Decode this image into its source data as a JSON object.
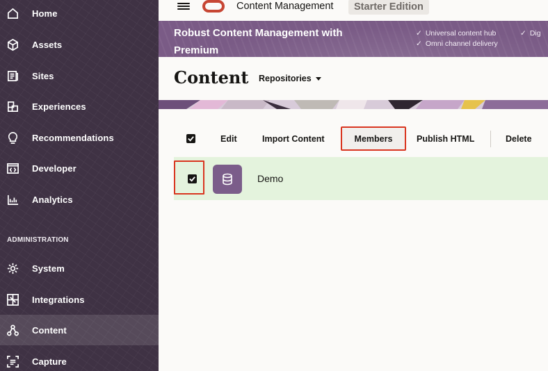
{
  "header": {
    "app_title": "Content Management",
    "edition": "Starter Edition"
  },
  "banner": {
    "title": "Robust Content Management with Premium",
    "features": [
      "Universal content hub",
      "Omni channel delivery",
      "Dig"
    ]
  },
  "sidebar": {
    "section_title": "ADMINISTRATION",
    "items": [
      {
        "label": "Home",
        "icon": "home-icon"
      },
      {
        "label": "Assets",
        "icon": "assets-icon"
      },
      {
        "label": "Sites",
        "icon": "sites-icon"
      },
      {
        "label": "Experiences",
        "icon": "experiences-icon"
      },
      {
        "label": "Recommendations",
        "icon": "recommendations-icon"
      },
      {
        "label": "Developer",
        "icon": "developer-icon"
      },
      {
        "label": "Analytics",
        "icon": "analytics-icon"
      },
      {
        "label": "System",
        "icon": "gear-icon"
      },
      {
        "label": "Integrations",
        "icon": "integrations-icon"
      },
      {
        "label": "Content",
        "icon": "content-icon",
        "active": true
      },
      {
        "label": "Capture",
        "icon": "capture-icon"
      }
    ]
  },
  "main": {
    "title": "Content",
    "repositories_label": "Repositories",
    "toolbar": {
      "edit": "Edit",
      "import_content": "Import Content",
      "members": "Members",
      "publish_html": "Publish HTML",
      "delete": "Delete"
    },
    "rows": [
      {
        "name": "Demo",
        "selected": true
      }
    ]
  },
  "colors": {
    "sidebar_bg": "#3f3244",
    "banner_bg": "#7a5b86",
    "accent_red": "#c74634",
    "highlight_border": "#d9351f",
    "selected_row_bg": "#e4f3dd",
    "repo_icon_bg": "#7b5d8a"
  }
}
